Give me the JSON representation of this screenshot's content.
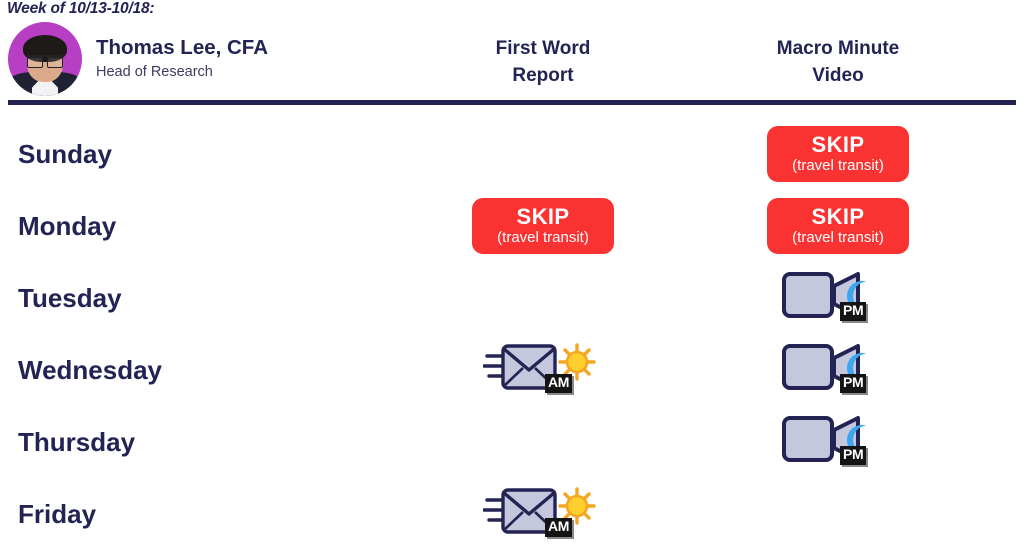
{
  "week_label": "Week of 10/13-10/18:",
  "analyst": {
    "name": "Thomas Lee, CFA",
    "role": "Head of Research",
    "avatar_name": "thomas-lee-avatar"
  },
  "columns": [
    {
      "line1": "First Word",
      "line2": "Report"
    },
    {
      "line1": "Macro Minute",
      "line2": "Video"
    }
  ],
  "colors": {
    "navy": "#232354",
    "skip_red": "#fa3232",
    "avatar_bg": "#b63fc4",
    "envelope_fill": "#c5c8dd",
    "camera_fill": "#c5c8dd",
    "sun": "#f5a623",
    "moon": "#3aa7f0",
    "tag_bg": "#141414"
  },
  "skip": {
    "title": "SKIP",
    "reason": "(travel transit)"
  },
  "tags": {
    "am": "AM",
    "pm": "PM"
  },
  "rows": [
    {
      "day": "Sunday",
      "first_word": {
        "type": "empty"
      },
      "macro_minute": {
        "type": "skip",
        "title": "SKIP",
        "reason": "(travel transit)"
      }
    },
    {
      "day": "Monday",
      "first_word": {
        "type": "skip",
        "title": "SKIP",
        "reason": "(travel transit)"
      },
      "macro_minute": {
        "type": "skip",
        "title": "SKIP",
        "reason": "(travel transit)"
      }
    },
    {
      "day": "Tuesday",
      "first_word": {
        "type": "empty"
      },
      "macro_minute": {
        "type": "video",
        "tag": "PM"
      }
    },
    {
      "day": "Wednesday",
      "first_word": {
        "type": "email",
        "tag": "AM"
      },
      "macro_minute": {
        "type": "video",
        "tag": "PM"
      }
    },
    {
      "day": "Thursday",
      "first_word": {
        "type": "empty"
      },
      "macro_minute": {
        "type": "video",
        "tag": "PM"
      }
    },
    {
      "day": "Friday",
      "first_word": {
        "type": "email",
        "tag": "AM"
      },
      "macro_minute": {
        "type": "empty"
      }
    }
  ]
}
